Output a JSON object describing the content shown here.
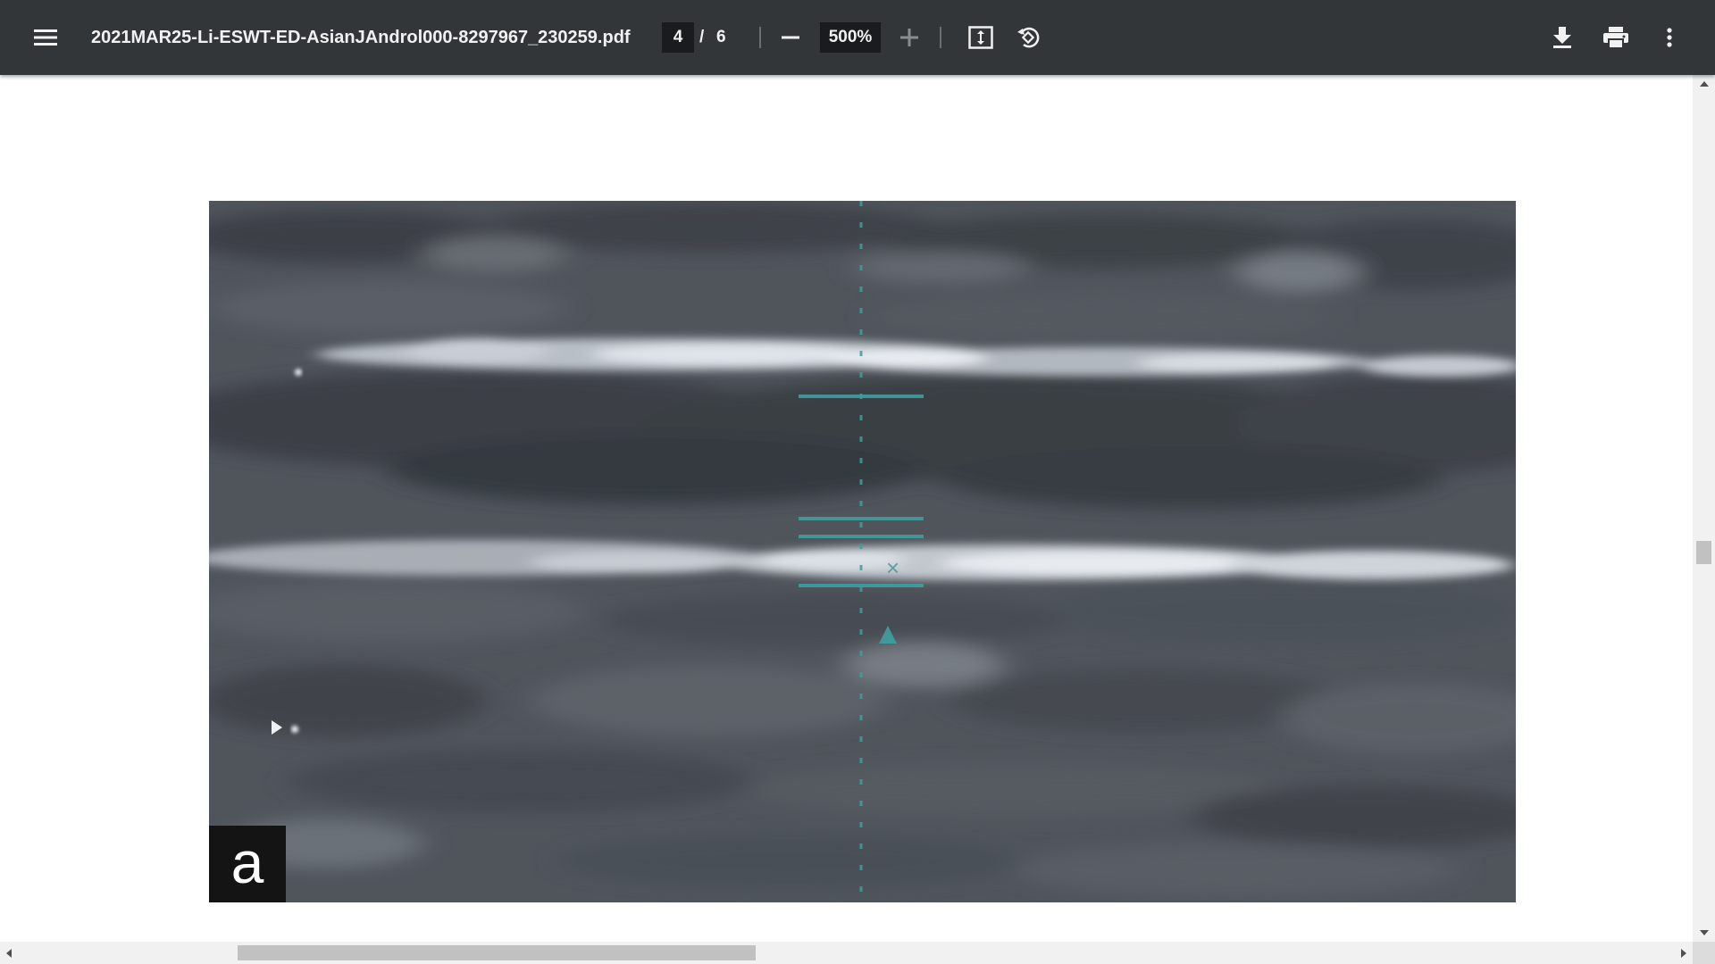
{
  "toolbar": {
    "file_name": "2021MAR25-Li-ESWT-ED-AsianJAndrol000-8297967_230259.pdf",
    "current_page": "4",
    "page_separator": "/",
    "total_pages": "6",
    "zoom": "500%",
    "icons": {
      "menu": "menu-icon",
      "zoom_out": "minus-icon",
      "zoom_in": "plus-icon",
      "fit": "fit-to-page-icon",
      "rotate": "rotate-counterclockwise-icon",
      "download": "download-icon",
      "print": "print-icon",
      "more": "more-vert-icon"
    }
  },
  "document": {
    "figure_panel_label": "a"
  },
  "colors": {
    "toolbar_bg": "#323639",
    "input_bg": "#191b1c",
    "caliper_teal": "#3f9ea0"
  }
}
